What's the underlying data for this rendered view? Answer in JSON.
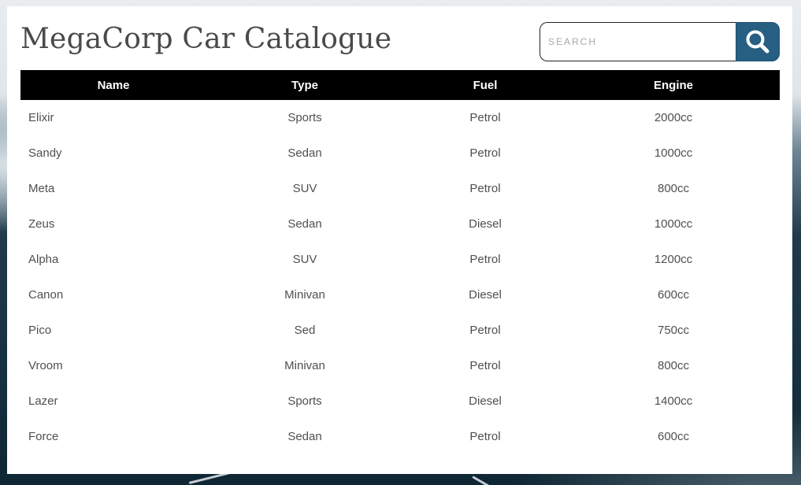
{
  "header": {
    "title": "MegaCorp Car Catalogue"
  },
  "search": {
    "placeholder": "SEARCH",
    "value": "",
    "button_icon": "search-icon",
    "button_color": "#275f82"
  },
  "table": {
    "headers": {
      "name": "Name",
      "type": "Type",
      "fuel": "Fuel",
      "engine": "Engine"
    },
    "rows": [
      {
        "name": "Elixir",
        "type": "Sports",
        "fuel": "Petrol",
        "engine": "2000cc"
      },
      {
        "name": "Sandy",
        "type": "Sedan",
        "fuel": "Petrol",
        "engine": "1000cc"
      },
      {
        "name": "Meta",
        "type": "SUV",
        "fuel": "Petrol",
        "engine": "800cc"
      },
      {
        "name": "Zeus",
        "type": "Sedan",
        "fuel": "Diesel",
        "engine": "1000cc"
      },
      {
        "name": "Alpha",
        "type": "SUV",
        "fuel": "Petrol",
        "engine": "1200cc"
      },
      {
        "name": "Canon",
        "type": "Minivan",
        "fuel": "Diesel",
        "engine": "600cc"
      },
      {
        "name": "Pico",
        "type": "Sed",
        "fuel": "Petrol",
        "engine": "750cc"
      },
      {
        "name": "Vroom",
        "type": "Minivan",
        "fuel": "Petrol",
        "engine": "800cc"
      },
      {
        "name": "Lazer",
        "type": "Sports",
        "fuel": "Diesel",
        "engine": "1400cc"
      },
      {
        "name": "Force",
        "type": "Sedan",
        "fuel": "Petrol",
        "engine": "600cc"
      }
    ]
  }
}
